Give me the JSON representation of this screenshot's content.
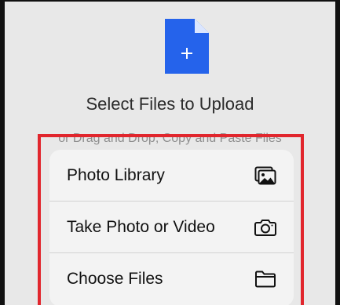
{
  "upload": {
    "title": "Select Files to Upload",
    "subtitle": "or Drag and Drop, Copy and Paste Files"
  },
  "menu": {
    "items": [
      {
        "label": "Photo Library",
        "icon": "photo-library-icon"
      },
      {
        "label": "Take Photo or Video",
        "icon": "camera-icon"
      },
      {
        "label": "Choose Files",
        "icon": "folder-icon"
      }
    ]
  },
  "colors": {
    "accent": "#2563eb",
    "highlight": "#e1262d"
  }
}
